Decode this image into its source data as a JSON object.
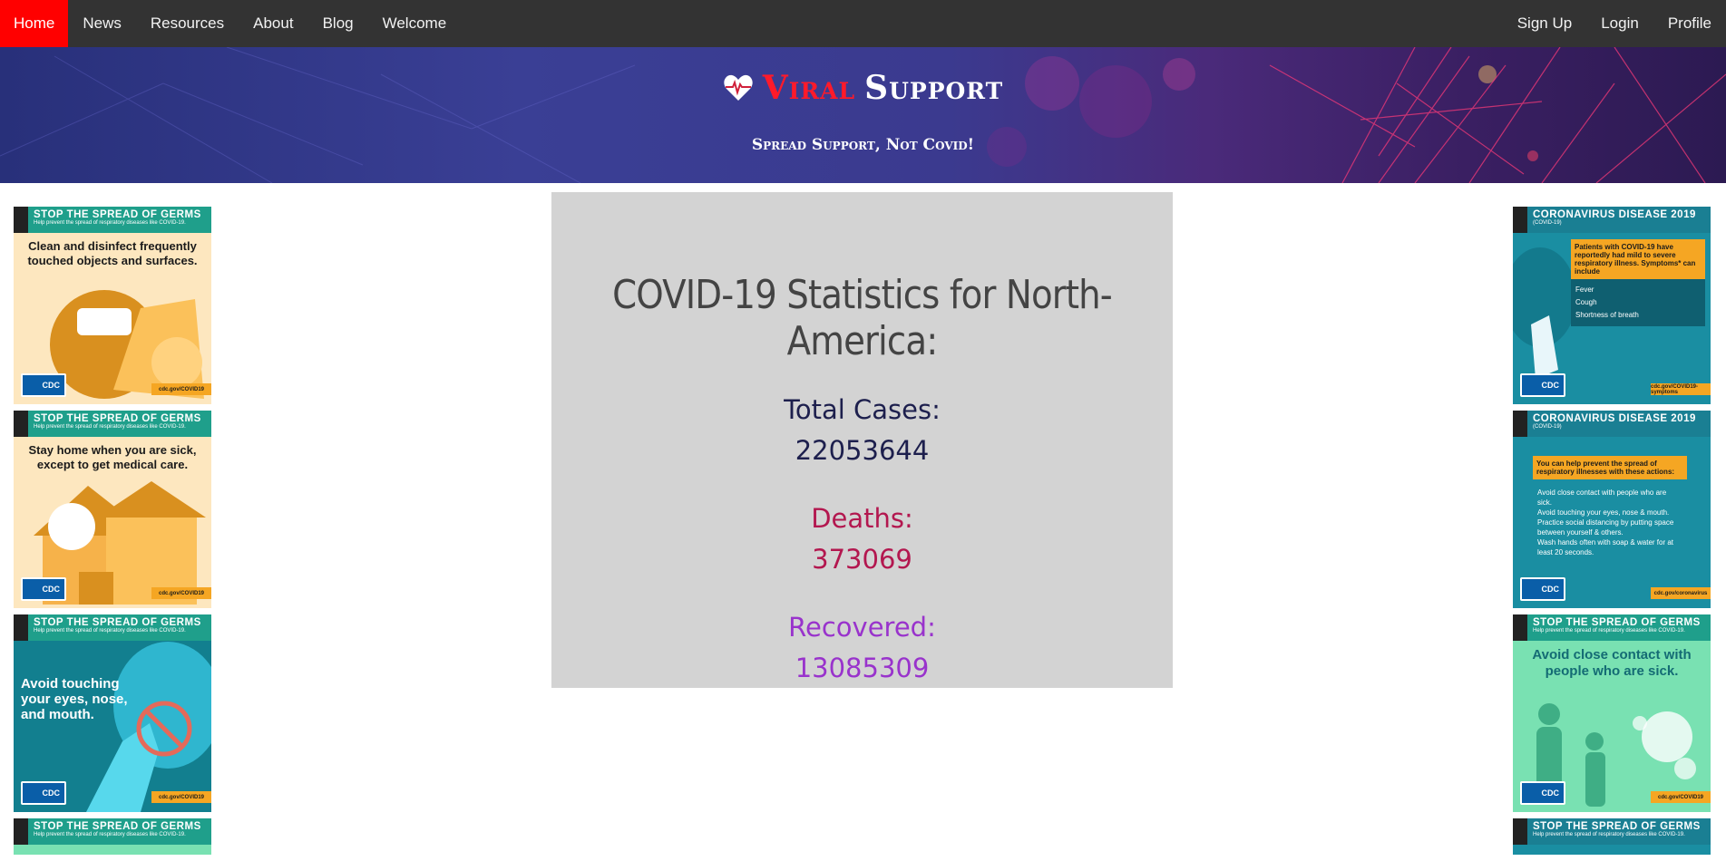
{
  "nav": {
    "left": [
      "Home",
      "News",
      "Resources",
      "About",
      "Blog",
      "Welcome"
    ],
    "right": [
      "Sign Up",
      "Login",
      "Profile"
    ],
    "active": "Home"
  },
  "banner": {
    "brand_red": "Viral",
    "brand_white": "Support",
    "tagline": "Spread Support, Not Covid!"
  },
  "stats": {
    "title": "COVID-19 Statistics for North-America:",
    "cases_label": "Total Cases:",
    "cases_value": "22053644",
    "deaths_label": "Deaths:",
    "deaths_value": "373069",
    "recovered_label": "Recovered:",
    "recovered_value": "13085309"
  },
  "posters_left": [
    {
      "header": "STOP THE SPREAD OF GERMS",
      "sub": "Help prevent the spread of respiratory diseases like COVID-19.",
      "text": "Clean and disinfect frequently touched objects and surfaces.",
      "url": "cdc.gov/COVID19"
    },
    {
      "header": "STOP THE SPREAD OF GERMS",
      "sub": "Help prevent the spread of respiratory diseases like COVID-19.",
      "text": "Stay home when you are sick, except to get medical care.",
      "url": "cdc.gov/COVID19"
    },
    {
      "header": "STOP THE SPREAD OF GERMS",
      "sub": "Help prevent the spread of respiratory diseases like COVID-19.",
      "text": "Avoid touching your eyes, nose, and mouth.",
      "url": "cdc.gov/COVID19"
    },
    {
      "header": "STOP THE SPREAD OF GERMS",
      "sub": "Help prevent the spread of respiratory diseases like COVID-19."
    }
  ],
  "posters_right": [
    {
      "header": "CORONAVIRUS DISEASE 2019",
      "sub": "(COVID-19)",
      "box": "Patients with COVID-19 have reportedly had mild to severe respiratory illness. Symptoms* can include",
      "items": [
        "Fever",
        "Cough",
        "Shortness of breath"
      ],
      "url": "cdc.gov/COVID19-symptoms"
    },
    {
      "header": "CORONAVIRUS DISEASE 2019",
      "sub": "(COVID-19)",
      "box": "You can help prevent the spread of respiratory illnesses with these actions:",
      "items": [
        "Avoid close contact with people who are sick.",
        "Avoid touching your eyes, nose & mouth.",
        "Practice social distancing by putting space between yourself & others.",
        "Wash hands often with soap & water for at least 20 seconds."
      ],
      "url": "cdc.gov/coronavirus"
    },
    {
      "header": "STOP THE SPREAD OF GERMS",
      "sub": "Help prevent the spread of respiratory diseases like COVID-19.",
      "text": "Avoid close contact with people who are sick.",
      "url": "cdc.gov/COVID19"
    },
    {
      "header": "STOP THE SPREAD OF GERMS",
      "sub": "Help prevent the spread of respiratory diseases like COVID-19."
    }
  ],
  "cdc_label": "CDC",
  "colors": {
    "nav_bg": "#333333",
    "nav_active": "#ff0000",
    "card_bg": "#d3d3d3",
    "cases": "#1d1f4d",
    "deaths": "#b3174f",
    "recovered": "#9933cc"
  }
}
